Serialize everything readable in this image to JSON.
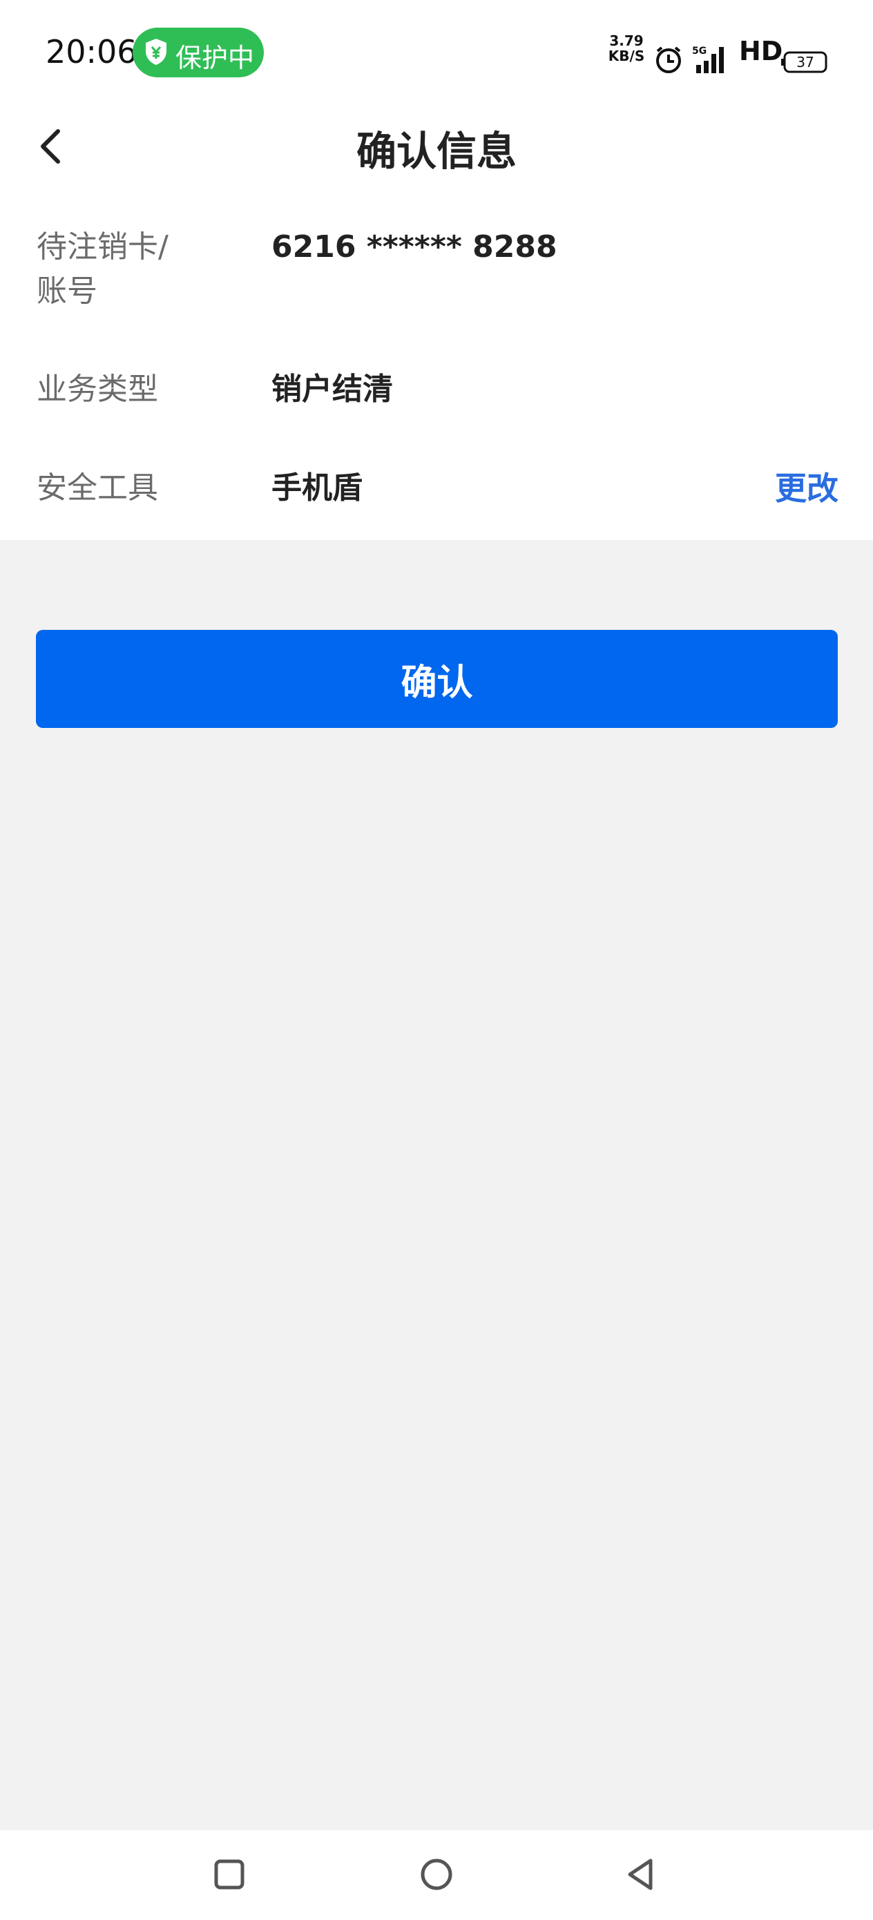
{
  "status_bar": {
    "time": "20:06",
    "protection_label": "保护中",
    "speed_value": "3.79",
    "speed_unit": "KB/S",
    "hd_label": "HD",
    "battery": "37",
    "icons": [
      "shield-icon",
      "alarm-icon",
      "signal-5g-icon",
      "battery-icon"
    ]
  },
  "header": {
    "title": "确认信息",
    "back_icon": "chevron-left-icon"
  },
  "info": {
    "rows": [
      {
        "label": "待注销卡/",
        "label_line2": "账号",
        "value": "6216 ****** 8288"
      },
      {
        "label": "业务类型",
        "value": "销户结清"
      },
      {
        "label": "安全工具",
        "value": "手机盾",
        "action": "更改"
      }
    ]
  },
  "confirm_button": {
    "label": "确认"
  },
  "system_nav": {
    "icons": [
      "recent-apps-icon",
      "home-icon",
      "back-icon"
    ]
  },
  "colors": {
    "primary": "#0067ee",
    "link": "#2a6de0",
    "protect_green": "#2fbe55",
    "background": "#f2f2f2"
  }
}
